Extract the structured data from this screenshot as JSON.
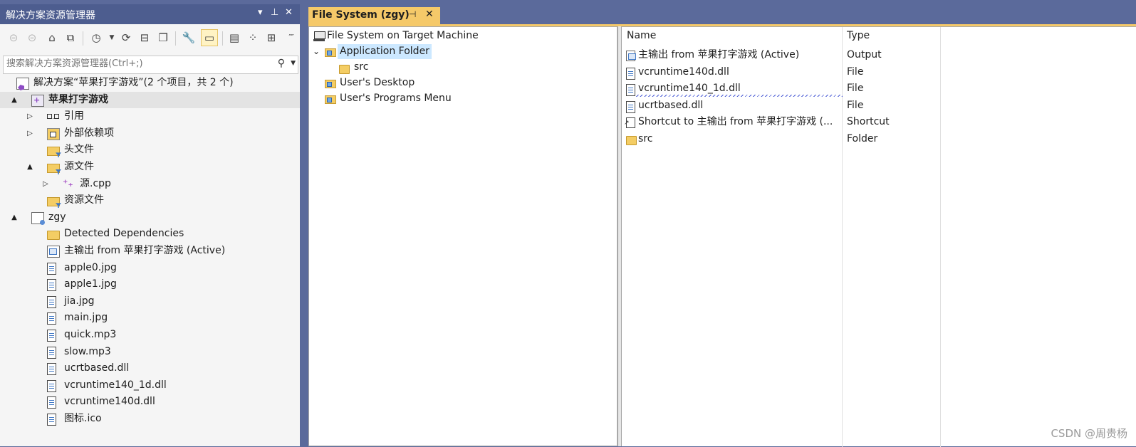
{
  "solution_explorer": {
    "title": "解决方案资源管理器",
    "title_controls": [
      "▾",
      "⊥",
      "✕"
    ],
    "search_placeholder": "搜索解决方案资源管理器(Ctrl+;)",
    "tree": [
      {
        "label": "解决方案“苹果打字游戏”(2 个项目，共 2 个)",
        "icon": "solution-icon",
        "level": 0,
        "expander": ""
      },
      {
        "label": "苹果打字游戏",
        "icon": "project-icon",
        "level": 1,
        "expander": "▲",
        "bold": true,
        "selected": true
      },
      {
        "label": "引用",
        "icon": "references-icon",
        "level": 2,
        "expander": "▷"
      },
      {
        "label": "外部依赖项",
        "icon": "external-deps-icon",
        "level": 2,
        "expander": "▷"
      },
      {
        "label": "头文件",
        "icon": "filter-folder-icon",
        "level": 2,
        "expander": ""
      },
      {
        "label": "源文件",
        "icon": "filter-folder-icon",
        "level": 2,
        "expander": "▲"
      },
      {
        "label": "源.cpp",
        "icon": "cpp-file-icon",
        "level": 3,
        "expander": "▷"
      },
      {
        "label": "资源文件",
        "icon": "filter-folder-icon",
        "level": 2,
        "expander": ""
      },
      {
        "label": "zgy",
        "icon": "setup-project-icon",
        "level": 1,
        "expander": "▲"
      },
      {
        "label": "Detected Dependencies",
        "icon": "folder-icon",
        "level": 2,
        "expander": ""
      },
      {
        "label": "主输出 from 苹果打字游戏 (Active)",
        "icon": "primary-output-icon",
        "level": 2,
        "expander": ""
      },
      {
        "label": "apple0.jpg",
        "icon": "file-icon",
        "level": 2,
        "expander": ""
      },
      {
        "label": "apple1.jpg",
        "icon": "file-icon",
        "level": 2,
        "expander": ""
      },
      {
        "label": "jia.jpg",
        "icon": "file-icon",
        "level": 2,
        "expander": ""
      },
      {
        "label": "main.jpg",
        "icon": "file-icon",
        "level": 2,
        "expander": ""
      },
      {
        "label": "quick.mp3",
        "icon": "file-icon",
        "level": 2,
        "expander": ""
      },
      {
        "label": "slow.mp3",
        "icon": "file-icon",
        "level": 2,
        "expander": ""
      },
      {
        "label": "ucrtbased.dll",
        "icon": "file-icon",
        "level": 2,
        "expander": ""
      },
      {
        "label": "vcruntime140_1d.dll",
        "icon": "file-icon",
        "level": 2,
        "expander": ""
      },
      {
        "label": "vcruntime140d.dll",
        "icon": "file-icon",
        "level": 2,
        "expander": ""
      },
      {
        "label": "图标.ico",
        "icon": "file-icon",
        "level": 2,
        "expander": ""
      }
    ]
  },
  "document_tab": {
    "title": "File System (zgy)",
    "pin_glyph": "⊣",
    "close_glyph": "✕"
  },
  "fs_tree": {
    "root": "File System on Target Machine",
    "expander": "⌄",
    "items": [
      {
        "label": "Application Folder",
        "selected": true
      },
      {
        "label": "src"
      },
      {
        "label": "User's Desktop"
      },
      {
        "label": "User's Programs Menu"
      }
    ]
  },
  "list": {
    "columns": [
      "Name",
      "Type"
    ],
    "rows": [
      {
        "name": "主输出 from 苹果打字游戏 (Active)",
        "type": "Output",
        "icon": "primary-output-icon"
      },
      {
        "name": "vcruntime140d.dll",
        "type": "File",
        "icon": "file-icon"
      },
      {
        "name": "vcruntime140_1d.dll",
        "type": "File",
        "icon": "file-icon",
        "squiggle": true
      },
      {
        "name": "ucrtbased.dll",
        "type": "File",
        "icon": "file-icon"
      },
      {
        "name": "Shortcut to 主输出 from 苹果打字游戏 (...",
        "type": "Shortcut",
        "icon": "shortcut-icon"
      },
      {
        "name": "src",
        "type": "Folder",
        "icon": "folder-icon"
      }
    ]
  },
  "watermark": "CSDN @周贵杨",
  "colors": {
    "title_bar": "#4d5d8f",
    "frame": "#5b6a9b",
    "active_tab": "#f5c969",
    "selection": "#cce8ff"
  }
}
